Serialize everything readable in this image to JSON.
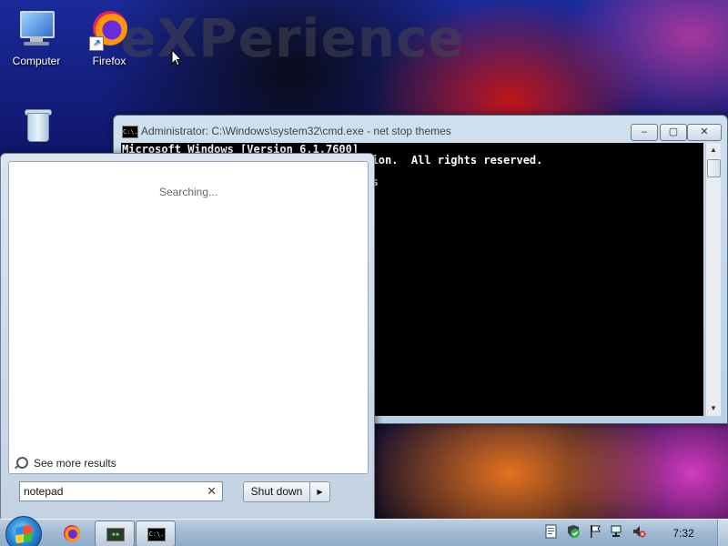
{
  "desktop": {
    "wallpaper_text": "eXPerience",
    "icons": [
      {
        "label": "Computer",
        "icon": "computer-icon"
      },
      {
        "label": "Firefox",
        "icon": "firefox-icon"
      },
      {
        "label": "",
        "icon": "recycle-bin-icon"
      }
    ]
  },
  "cmd_window": {
    "title": "Administrator: C:\\Windows\\system32\\cmd.exe - net  stop themes",
    "icon_text": "C:\\.",
    "buttons": {
      "minimize": "‒",
      "maximize": "▢",
      "close": "✕"
    },
    "lines": [
      "Microsoft Windows [Version 6.1.7600]",
      "                                    ation.  All rights reserved.",
      "",
      "                                    mes"
    ]
  },
  "start_menu": {
    "status_text": "Searching...",
    "see_more_label": "See more results",
    "search": {
      "value": "notepad",
      "clear_glyph": "✕"
    },
    "shutdown_label": "Shut down",
    "shutdown_arrow": "▶"
  },
  "taskbar": {
    "clock": "7:32",
    "apps": [
      {
        "name": "firefox",
        "icon": "firefox-icon"
      },
      {
        "name": "app",
        "icon": "console-icon",
        "icon_text": "▪▪"
      },
      {
        "name": "cmd",
        "icon": "cmd-icon",
        "icon_text": "C:\\."
      }
    ],
    "tray_icons": [
      "document-icon",
      "security-icon",
      "flag-icon",
      "network-icon",
      "volume-muted-icon"
    ]
  }
}
